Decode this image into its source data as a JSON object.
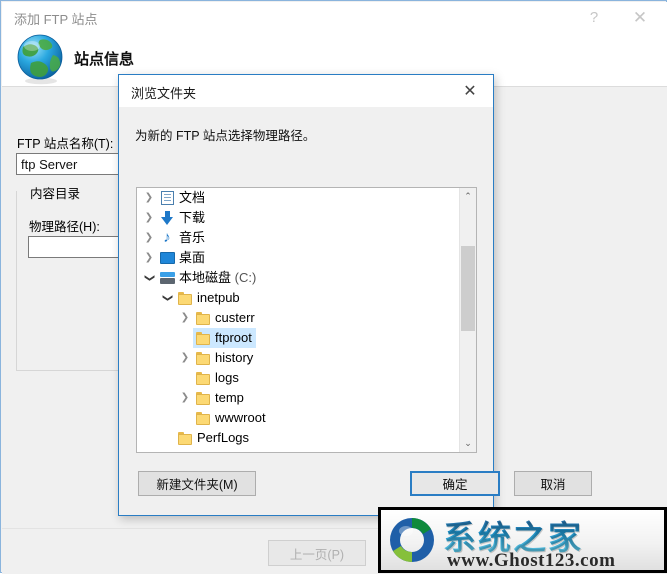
{
  "wizard": {
    "title": "添加 FTP 站点",
    "help_label": "?",
    "close_label": "✕",
    "page_title": "站点信息",
    "site_name_label": "FTP 站点名称(T):",
    "site_name_value": "ftp Server",
    "site_name_placeholder": "",
    "content_group_title": "内容目录",
    "physical_path_label": "物理路径(H):",
    "physical_path_value": "",
    "physical_path_placeholder": "",
    "prev_button_label": "上一页(P)"
  },
  "browse_dialog": {
    "title": "浏览文件夹",
    "close_label": "✕",
    "instruction": "为新的 FTP 站点选择物理路径。",
    "new_folder_label": "新建文件夹(M)",
    "ok_label": "确定",
    "cancel_label": "取消",
    "scrollbar": {
      "up_arrow": "⌃",
      "down_arrow": "⌄"
    },
    "tree": [
      {
        "label": "文档",
        "suffix": "",
        "icon": "documents-icon",
        "indent": 1,
        "chevron": "collapsed",
        "selected": false
      },
      {
        "label": "下载",
        "suffix": "",
        "icon": "downloads-icon",
        "indent": 1,
        "chevron": "collapsed",
        "selected": false
      },
      {
        "label": "音乐",
        "suffix": "",
        "icon": "music-icon",
        "indent": 1,
        "chevron": "collapsed",
        "selected": false
      },
      {
        "label": "桌面",
        "suffix": "",
        "icon": "desktop-icon",
        "indent": 1,
        "chevron": "collapsed",
        "selected": false
      },
      {
        "label": "本地磁盘",
        "suffix": " (C:)",
        "icon": "disk-icon",
        "indent": 1,
        "chevron": "expanded",
        "selected": false
      },
      {
        "label": "inetpub",
        "suffix": "",
        "icon": "folder-icon",
        "indent": 2,
        "chevron": "expanded",
        "selected": false
      },
      {
        "label": "custerr",
        "suffix": "",
        "icon": "folder-icon",
        "indent": 3,
        "chevron": "collapsed",
        "selected": false
      },
      {
        "label": "ftproot",
        "suffix": "",
        "icon": "folder-icon",
        "indent": 3,
        "chevron": "none",
        "selected": true
      },
      {
        "label": "history",
        "suffix": "",
        "icon": "folder-icon",
        "indent": 3,
        "chevron": "collapsed",
        "selected": false
      },
      {
        "label": "logs",
        "suffix": "",
        "icon": "folder-icon",
        "indent": 3,
        "chevron": "none",
        "selected": false
      },
      {
        "label": "temp",
        "suffix": "",
        "icon": "folder-icon",
        "indent": 3,
        "chevron": "collapsed",
        "selected": false
      },
      {
        "label": "wwwroot",
        "suffix": "",
        "icon": "folder-icon",
        "indent": 3,
        "chevron": "none",
        "selected": false
      },
      {
        "label": "PerfLogs",
        "suffix": "",
        "icon": "folder-icon",
        "indent": 2,
        "chevron": "none",
        "selected": false
      }
    ]
  },
  "watermark": {
    "brand_cn": "系统之家",
    "url": "www.Ghost123.com"
  },
  "colors": {
    "accent_blue": "#2a7dc4",
    "selection_blue": "#cce8ff",
    "folder_yellow": "#fcd974",
    "window_gray": "#f0f0f0",
    "disabled_text": "#b0b0b0"
  }
}
